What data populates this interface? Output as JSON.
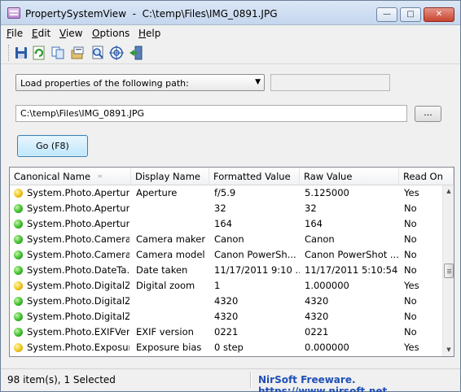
{
  "window": {
    "title": "PropertySystemView  -  C:\\temp\\Files\\IMG_0891.JPG"
  },
  "menu": [
    {
      "label": "File",
      "accel": "F",
      "rest": "ile"
    },
    {
      "label": "Edit",
      "accel": "E",
      "rest": "dit"
    },
    {
      "label": "View",
      "accel": "V",
      "rest": "iew"
    },
    {
      "label": "Options",
      "accel": "O",
      "rest": "ptions"
    },
    {
      "label": "Help",
      "accel": "H",
      "rest": "elp"
    }
  ],
  "toolbar": {
    "icons": [
      "save-icon",
      "refresh-icon",
      "copy-icon",
      "properties-icon",
      "find-icon",
      "target-icon",
      "exit-icon"
    ]
  },
  "controls": {
    "mode_select": "Load properties of the following path:",
    "path_value": "C:\\temp\\Files\\IMG_0891.JPG",
    "browse_label": "...",
    "go_label": "Go (F8)"
  },
  "table": {
    "columns": [
      "Canonical Name",
      "Display Name",
      "Formatted Value",
      "Raw Value",
      "Read On"
    ],
    "rows": [
      {
        "status": "yellow",
        "canonical": "System.Photo.Aperture",
        "display": "Aperture",
        "formatted": "f/5.9",
        "raw": "5.125000",
        "readonly": "Yes"
      },
      {
        "status": "green",
        "canonical": "System.Photo.Apertur...",
        "display": "",
        "formatted": "32",
        "raw": "32",
        "readonly": "No"
      },
      {
        "status": "green",
        "canonical": "System.Photo.Apertur...",
        "display": "",
        "formatted": "164",
        "raw": "164",
        "readonly": "No"
      },
      {
        "status": "green",
        "canonical": "System.Photo.Camera...",
        "display": "Camera maker",
        "formatted": "Canon",
        "raw": "Canon",
        "readonly": "No"
      },
      {
        "status": "green",
        "canonical": "System.Photo.Camera...",
        "display": "Camera model",
        "formatted": "Canon PowerSh...",
        "raw": "Canon PowerShot ...",
        "readonly": "No"
      },
      {
        "status": "green",
        "canonical": "System.Photo.DateTa...",
        "display": "Date taken",
        "formatted": "11/17/2011 9:10 ...",
        "raw": "11/17/2011 5:10:54 ...",
        "readonly": "No"
      },
      {
        "status": "yellow",
        "canonical": "System.Photo.DigitalZ...",
        "display": "Digital zoom",
        "formatted": "1",
        "raw": "1.000000",
        "readonly": "Yes"
      },
      {
        "status": "green",
        "canonical": "System.Photo.DigitalZ...",
        "display": "",
        "formatted": "4320",
        "raw": "4320",
        "readonly": "No"
      },
      {
        "status": "green",
        "canonical": "System.Photo.DigitalZ...",
        "display": "",
        "formatted": "4320",
        "raw": "4320",
        "readonly": "No"
      },
      {
        "status": "green",
        "canonical": "System.Photo.EXIFVer...",
        "display": "EXIF version",
        "formatted": "0221",
        "raw": "0221",
        "readonly": "No"
      },
      {
        "status": "yellow",
        "canonical": "System.Photo.Exposur...",
        "display": "Exposure bias",
        "formatted": "0 step",
        "raw": "0.000000",
        "readonly": "Yes"
      }
    ]
  },
  "status": {
    "items": "98 item(s), 1 Selected",
    "link": "NirSoft Freeware. https://www.nirsoft.net"
  },
  "colors": {
    "status_yellow": "#f0c419",
    "status_green": "#3cbe2c",
    "link": "#1f4fb5"
  }
}
